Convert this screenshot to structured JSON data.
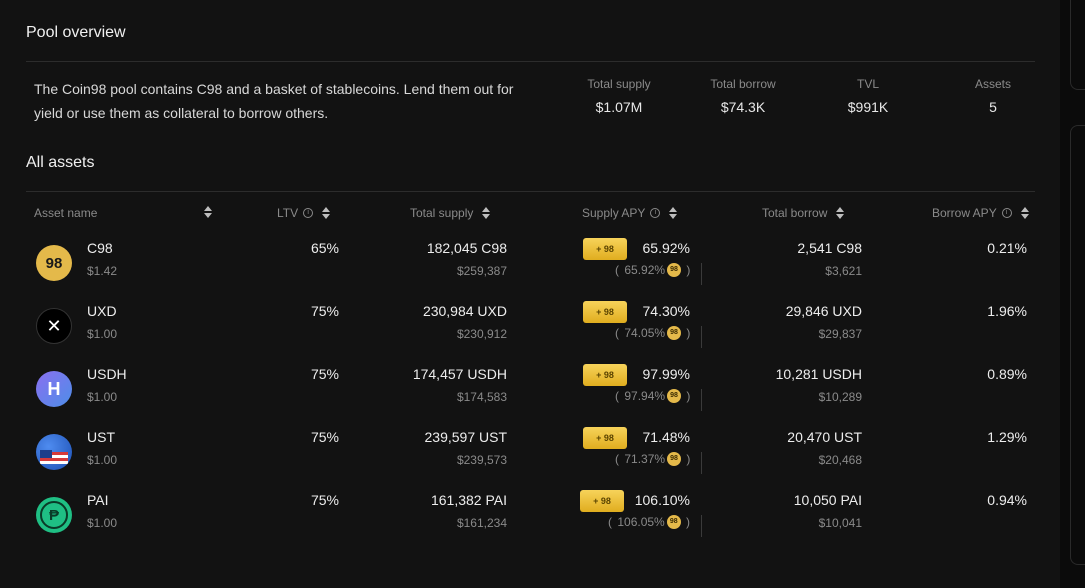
{
  "pool_overview": {
    "title": "Pool overview",
    "description": "The Coin98 pool contains C98 and a basket of stablecoins. Lend them out for yield or use them as collateral to borrow others.",
    "stats": [
      {
        "label": "Total supply",
        "value": "$1.07M"
      },
      {
        "label": "Total borrow",
        "value": "$74.3K"
      },
      {
        "label": "TVL",
        "value": "$991K"
      },
      {
        "label": "Assets",
        "value": "5"
      }
    ]
  },
  "all_assets": {
    "title": "All assets",
    "columns": {
      "asset_name": "Asset name",
      "ltv": "LTV",
      "total_supply": "Total supply",
      "supply_apy": "Supply APY",
      "total_borrow": "Total borrow",
      "borrow_apy": "Borrow APY"
    },
    "boost_label": "+ 98",
    "rows": [
      {
        "symbol": "C98",
        "price": "$1.42",
        "ltv": "65%",
        "supply": "182,045 C98",
        "supply_usd": "$259,387",
        "supply_apy": "65.92%",
        "base_apy": "65.92%",
        "borrow": "2,541 C98",
        "borrow_usd": "$3,621",
        "borrow_apy": "0.21%",
        "icon": "c98-icon",
        "color": "#e4b94a"
      },
      {
        "symbol": "UXD",
        "price": "$1.00",
        "ltv": "75%",
        "supply": "230,984 UXD",
        "supply_usd": "$230,912",
        "supply_apy": "74.30%",
        "base_apy": "74.05%",
        "borrow": "29,846 UXD",
        "borrow_usd": "$29,837",
        "borrow_apy": "1.96%",
        "icon": "uxd-icon",
        "color": "#000000"
      },
      {
        "symbol": "USDH",
        "price": "$1.00",
        "ltv": "75%",
        "supply": "174,457 USDH",
        "supply_usd": "$174,583",
        "supply_apy": "97.99%",
        "base_apy": "97.94%",
        "borrow": "10,281 USDH",
        "borrow_usd": "$10,289",
        "borrow_apy": "0.89%",
        "icon": "usdh-icon",
        "color": "#6f5bd8"
      },
      {
        "symbol": "UST",
        "price": "$1.00",
        "ltv": "75%",
        "supply": "239,597 UST",
        "supply_usd": "$239,573",
        "supply_apy": "71.48%",
        "base_apy": "71.37%",
        "borrow": "20,470 UST",
        "borrow_usd": "$20,468",
        "borrow_apy": "1.29%",
        "icon": "ust-icon",
        "color": "#2f6bd6"
      },
      {
        "symbol": "PAI",
        "price": "$1.00",
        "ltv": "75%",
        "supply": "161,382 PAI",
        "supply_usd": "$161,234",
        "supply_apy": "106.10%",
        "base_apy": "106.05%",
        "borrow": "10,050 PAI",
        "borrow_usd": "$10,041",
        "borrow_apy": "0.94%",
        "icon": "pai-icon",
        "color": "#1fbf84"
      }
    ]
  }
}
